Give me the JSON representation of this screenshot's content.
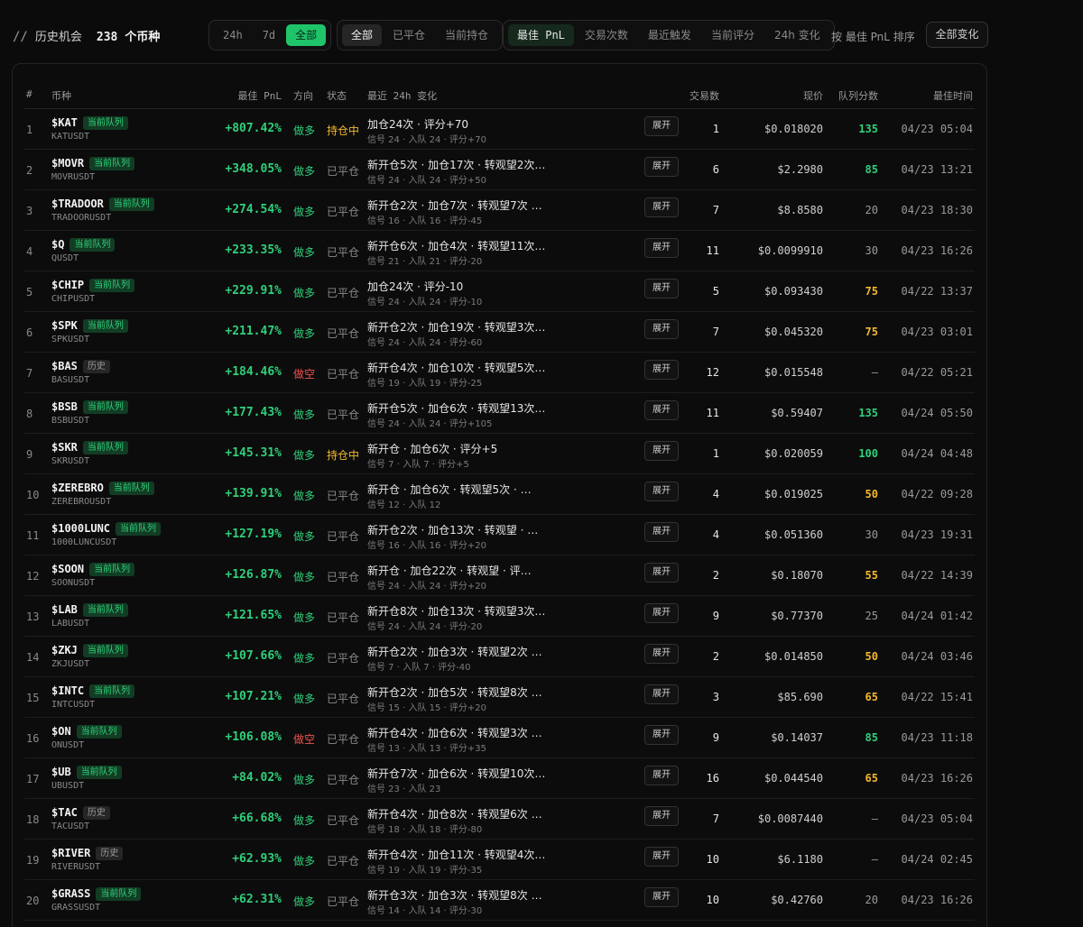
{
  "header": {
    "slash": "//",
    "title": "历史机会",
    "count": "238",
    "count_unit": "个币种",
    "time_filters": [
      "24h",
      "7d",
      "全部"
    ],
    "status_filters": [
      "全部",
      "已平仓",
      "当前持仓"
    ],
    "sort_options": [
      "最佳 PnL",
      "交易次数",
      "最近触发",
      "当前评分",
      "24h 变化"
    ],
    "sort_label": "按 最佳 PnL 排序",
    "all_changes_button": "全部变化"
  },
  "table": {
    "columns": {
      "index": "#",
      "symbol": "币种",
      "best_pnl": "最佳 PnL",
      "direction": "方向",
      "status": "状态",
      "recent_change": "最近 24h 变化",
      "trades": "交易数",
      "price": "现价",
      "queue_score": "队列分数",
      "best_time": "最佳时间"
    },
    "expand_label": "展开",
    "rows": [
      {
        "idx": "1",
        "symbol": "$KAT",
        "badge": "当前队列",
        "badge_type": "queue",
        "pair": "KATUSDT",
        "pnl": "+807.42%",
        "dir": "做多",
        "dir_type": "long",
        "status": "持仓中",
        "status_type": "open",
        "change": "加仓24次 · 评分+70",
        "detail": "信号 24 · 入队 24 · 评分+70",
        "trades": "1",
        "price": "$0.018020",
        "score": "135",
        "score_type": "green",
        "time": "04/23 05:04"
      },
      {
        "idx": "2",
        "symbol": "$MOVR",
        "badge": "当前队列",
        "badge_type": "queue",
        "pair": "MOVRUSDT",
        "pnl": "+348.05%",
        "dir": "做多",
        "dir_type": "long",
        "status": "已平仓",
        "status_type": "closed",
        "change": "新开仓5次 · 加仓17次 · 转观望2次…",
        "detail": "信号 24 · 入队 24 · 评分+50",
        "trades": "6",
        "price": "$2.2980",
        "score": "85",
        "score_type": "green",
        "time": "04/23 13:21"
      },
      {
        "idx": "3",
        "symbol": "$TRADOOR",
        "badge": "当前队列",
        "badge_type": "queue",
        "pair": "TRADOORUSDT",
        "pnl": "+274.54%",
        "dir": "做多",
        "dir_type": "long",
        "status": "已平仓",
        "status_type": "closed",
        "change": "新开仓2次 · 加仓7次 · 转观望7次 …",
        "detail": "信号 16 · 入队 16 · 评分-45",
        "trades": "7",
        "price": "$8.8580",
        "score": "20",
        "score_type": "gray",
        "time": "04/23 18:30"
      },
      {
        "idx": "4",
        "symbol": "$Q",
        "badge": "当前队列",
        "badge_type": "queue",
        "pair": "QUSDT",
        "pnl": "+233.35%",
        "dir": "做多",
        "dir_type": "long",
        "status": "已平仓",
        "status_type": "closed",
        "change": "新开仓6次 · 加仓4次 · 转观望11次…",
        "detail": "信号 21 · 入队 21 · 评分-20",
        "trades": "11",
        "price": "$0.0099910",
        "score": "30",
        "score_type": "gray",
        "time": "04/23 16:26"
      },
      {
        "idx": "5",
        "symbol": "$CHIP",
        "badge": "当前队列",
        "badge_type": "queue",
        "pair": "CHIPUSDT",
        "pnl": "+229.91%",
        "dir": "做多",
        "dir_type": "long",
        "status": "已平仓",
        "status_type": "closed",
        "change": "加仓24次 · 评分-10",
        "detail": "信号 24 · 入队 24 · 评分-10",
        "trades": "5",
        "price": "$0.093430",
        "score": "75",
        "score_type": "yellow",
        "time": "04/22 13:37"
      },
      {
        "idx": "6",
        "symbol": "$SPK",
        "badge": "当前队列",
        "badge_type": "queue",
        "pair": "SPKUSDT",
        "pnl": "+211.47%",
        "dir": "做多",
        "dir_type": "long",
        "status": "已平仓",
        "status_type": "closed",
        "change": "新开仓2次 · 加仓19次 · 转观望3次…",
        "detail": "信号 24 · 入队 24 · 评分-60",
        "trades": "7",
        "price": "$0.045320",
        "score": "75",
        "score_type": "yellow",
        "time": "04/23 03:01"
      },
      {
        "idx": "7",
        "symbol": "$BAS",
        "badge": "历史",
        "badge_type": "hist",
        "pair": "BASUSDT",
        "pnl": "+184.46%",
        "dir": "做空",
        "dir_type": "short",
        "status": "已平仓",
        "status_type": "closed",
        "change": "新开仓4次 · 加仓10次 · 转观望5次…",
        "detail": "信号 19 · 入队 19 · 评分-25",
        "trades": "12",
        "price": "$0.015548",
        "score": "—",
        "score_type": "gray",
        "time": "04/22 05:21"
      },
      {
        "idx": "8",
        "symbol": "$BSB",
        "badge": "当前队列",
        "badge_type": "queue",
        "pair": "BSBUSDT",
        "pnl": "+177.43%",
        "dir": "做多",
        "dir_type": "long",
        "status": "已平仓",
        "status_type": "closed",
        "change": "新开仓5次 · 加仓6次 · 转观望13次…",
        "detail": "信号 24 · 入队 24 · 评分+105",
        "trades": "11",
        "price": "$0.59407",
        "score": "135",
        "score_type": "green",
        "time": "04/24 05:50"
      },
      {
        "idx": "9",
        "symbol": "$SKR",
        "badge": "当前队列",
        "badge_type": "queue",
        "pair": "SKRUSDT",
        "pnl": "+145.31%",
        "dir": "做多",
        "dir_type": "long",
        "status": "持仓中",
        "status_type": "open",
        "change": "新开仓 · 加仓6次 · 评分+5",
        "detail": "信号 7 · 入队 7 · 评分+5",
        "trades": "1",
        "price": "$0.020059",
        "score": "100",
        "score_type": "green",
        "time": "04/24 04:48"
      },
      {
        "idx": "10",
        "symbol": "$ZEREBRO",
        "badge": "当前队列",
        "badge_type": "queue",
        "pair": "ZEREBROUSDT",
        "pnl": "+139.91%",
        "dir": "做多",
        "dir_type": "long",
        "status": "已平仓",
        "status_type": "closed",
        "change": "新开仓 · 加仓6次 · 转观望5次 · …",
        "detail": "信号 12 · 入队 12",
        "trades": "4",
        "price": "$0.019025",
        "score": "50",
        "score_type": "yellow",
        "time": "04/22 09:28"
      },
      {
        "idx": "11",
        "symbol": "$1000LUNC",
        "badge": "当前队列",
        "badge_type": "queue",
        "pair": "1000LUNCUSDT",
        "pnl": "+127.19%",
        "dir": "做多",
        "dir_type": "long",
        "status": "已平仓",
        "status_type": "closed",
        "change": "新开仓2次 · 加仓13次 · 转观望 · …",
        "detail": "信号 16 · 入队 16 · 评分+20",
        "trades": "4",
        "price": "$0.051360",
        "score": "30",
        "score_type": "gray",
        "time": "04/23 19:31"
      },
      {
        "idx": "12",
        "symbol": "$SOON",
        "badge": "当前队列",
        "badge_type": "queue",
        "pair": "SOONUSDT",
        "pnl": "+126.87%",
        "dir": "做多",
        "dir_type": "long",
        "status": "已平仓",
        "status_type": "closed",
        "change": "新开仓 · 加仓22次 · 转观望 · 评…",
        "detail": "信号 24 · 入队 24 · 评分+20",
        "trades": "2",
        "price": "$0.18070",
        "score": "55",
        "score_type": "yellow",
        "time": "04/22 14:39"
      },
      {
        "idx": "13",
        "symbol": "$LAB",
        "badge": "当前队列",
        "badge_type": "queue",
        "pair": "LABUSDT",
        "pnl": "+121.65%",
        "dir": "做多",
        "dir_type": "long",
        "status": "已平仓",
        "status_type": "closed",
        "change": "新开仓8次 · 加仓13次 · 转观望3次…",
        "detail": "信号 24 · 入队 24 · 评分-20",
        "trades": "9",
        "price": "$0.77370",
        "score": "25",
        "score_type": "gray",
        "time": "04/24 01:42"
      },
      {
        "idx": "14",
        "symbol": "$ZKJ",
        "badge": "当前队列",
        "badge_type": "queue",
        "pair": "ZKJUSDT",
        "pnl": "+107.66%",
        "dir": "做多",
        "dir_type": "long",
        "status": "已平仓",
        "status_type": "closed",
        "change": "新开仓2次 · 加仓3次 · 转观望2次 …",
        "detail": "信号 7 · 入队 7 · 评分-40",
        "trades": "2",
        "price": "$0.014850",
        "score": "50",
        "score_type": "yellow",
        "time": "04/24 03:46"
      },
      {
        "idx": "15",
        "symbol": "$INTC",
        "badge": "当前队列",
        "badge_type": "queue",
        "pair": "INTCUSDT",
        "pnl": "+107.21%",
        "dir": "做多",
        "dir_type": "long",
        "status": "已平仓",
        "status_type": "closed",
        "change": "新开仓2次 · 加仓5次 · 转观望8次 …",
        "detail": "信号 15 · 入队 15 · 评分+20",
        "trades": "3",
        "price": "$85.690",
        "score": "65",
        "score_type": "yellow",
        "time": "04/22 15:41"
      },
      {
        "idx": "16",
        "symbol": "$ON",
        "badge": "当前队列",
        "badge_type": "queue",
        "pair": "ONUSDT",
        "pnl": "+106.08%",
        "dir": "做空",
        "dir_type": "short",
        "status": "已平仓",
        "status_type": "closed",
        "change": "新开仓4次 · 加仓6次 · 转观望3次 …",
        "detail": "信号 13 · 入队 13 · 评分+35",
        "trades": "9",
        "price": "$0.14037",
        "score": "85",
        "score_type": "green",
        "time": "04/23 11:18"
      },
      {
        "idx": "17",
        "symbol": "$UB",
        "badge": "当前队列",
        "badge_type": "queue",
        "pair": "UBUSDT",
        "pnl": "+84.02%",
        "dir": "做多",
        "dir_type": "long",
        "status": "已平仓",
        "status_type": "closed",
        "change": "新开仓7次 · 加仓6次 · 转观望10次…",
        "detail": "信号 23 · 入队 23",
        "trades": "16",
        "price": "$0.044540",
        "score": "65",
        "score_type": "yellow",
        "time": "04/23 16:26"
      },
      {
        "idx": "18",
        "symbol": "$TAC",
        "badge": "历史",
        "badge_type": "hist",
        "pair": "TACUSDT",
        "pnl": "+66.68%",
        "dir": "做多",
        "dir_type": "long",
        "status": "已平仓",
        "status_type": "closed",
        "change": "新开仓4次 · 加仓8次 · 转观望6次 …",
        "detail": "信号 18 · 入队 18 · 评分-80",
        "trades": "7",
        "price": "$0.0087440",
        "score": "—",
        "score_type": "gray",
        "time": "04/23 05:04"
      },
      {
        "idx": "19",
        "symbol": "$RIVER",
        "badge": "历史",
        "badge_type": "hist",
        "pair": "RIVERUSDT",
        "pnl": "+62.93%",
        "dir": "做多",
        "dir_type": "long",
        "status": "已平仓",
        "status_type": "closed",
        "change": "新开仓4次 · 加仓11次 · 转观望4次…",
        "detail": "信号 19 · 入队 19 · 评分-35",
        "trades": "10",
        "price": "$6.1180",
        "score": "—",
        "score_type": "gray",
        "time": "04/24 02:45"
      },
      {
        "idx": "20",
        "symbol": "$GRASS",
        "badge": "当前队列",
        "badge_type": "queue",
        "pair": "GRASSUSDT",
        "pnl": "+62.31%",
        "dir": "做多",
        "dir_type": "long",
        "status": "已平仓",
        "status_type": "closed",
        "change": "新开仓3次 · 加仓3次 · 转观望8次 …",
        "detail": "信号 14 · 入队 14 · 评分-30",
        "trades": "10",
        "price": "$0.42760",
        "score": "20",
        "score_type": "gray",
        "time": "04/23 16:26"
      }
    ]
  },
  "colors": {
    "background": "#0b0b0b",
    "accent_green": "#1fc46a",
    "positive": "#2fd07a",
    "negative": "#f05252",
    "warning": "#f5b82e"
  }
}
